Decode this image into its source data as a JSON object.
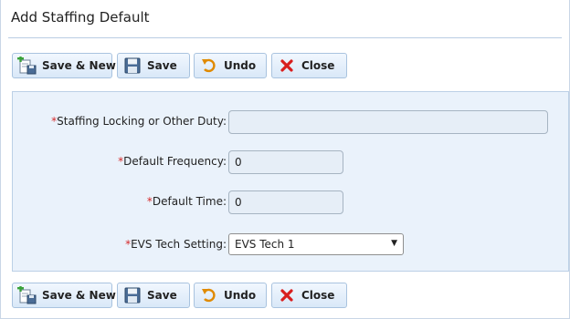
{
  "dialog": {
    "title": "Add Staffing Default"
  },
  "toolbar": {
    "save_new_label": "Save & New",
    "save_label": "Save",
    "undo_label": "Undo",
    "close_label": "Close"
  },
  "form": {
    "required_marker": "*",
    "staffing_locking": {
      "label": "Staffing Locking or Other Duty:",
      "value": ""
    },
    "default_frequency": {
      "label": "Default Frequency:",
      "value": "0"
    },
    "default_time": {
      "label": "Default Time:",
      "value": "0"
    },
    "evs_tech_setting": {
      "label": "EVS Tech Setting:",
      "value": "EVS Tech 1"
    }
  },
  "icons": {
    "save_new": "save-new-icon",
    "save": "floppy-disk-icon",
    "undo": "undo-icon",
    "close": "close-x-icon"
  },
  "colors": {
    "panel_bg": "#eaf2fb",
    "button_border": "#a9c3df",
    "required": "#d62a2a",
    "undo_icon": "#e08a00",
    "close_icon": "#d81e1e"
  }
}
